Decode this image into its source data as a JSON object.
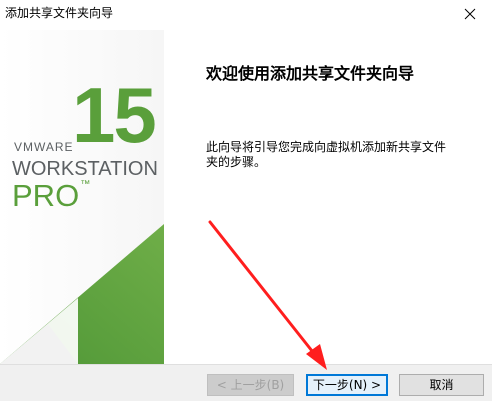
{
  "window": {
    "title": "添加共享文件夹向导"
  },
  "banner": {
    "logo_number": "15",
    "logo_vmware": "VMWARE",
    "logo_workstation": "WORKSTATION",
    "logo_pro": "PRO",
    "logo_tm": "™",
    "green_color": "#5a9f3b"
  },
  "main": {
    "heading": "欢迎使用添加共享文件夹向导",
    "description": "此向导将引导您完成向虚拟机添加新共享文件夹的步骤。"
  },
  "buttons": {
    "back_label": "< 上一步(B)",
    "next_label": "下一步(N) >",
    "cancel_label": "取消"
  },
  "annotation": {
    "arrow_color": "#ff1e1e",
    "points_to": "next-button"
  },
  "icons": {
    "close": "close-icon"
  }
}
